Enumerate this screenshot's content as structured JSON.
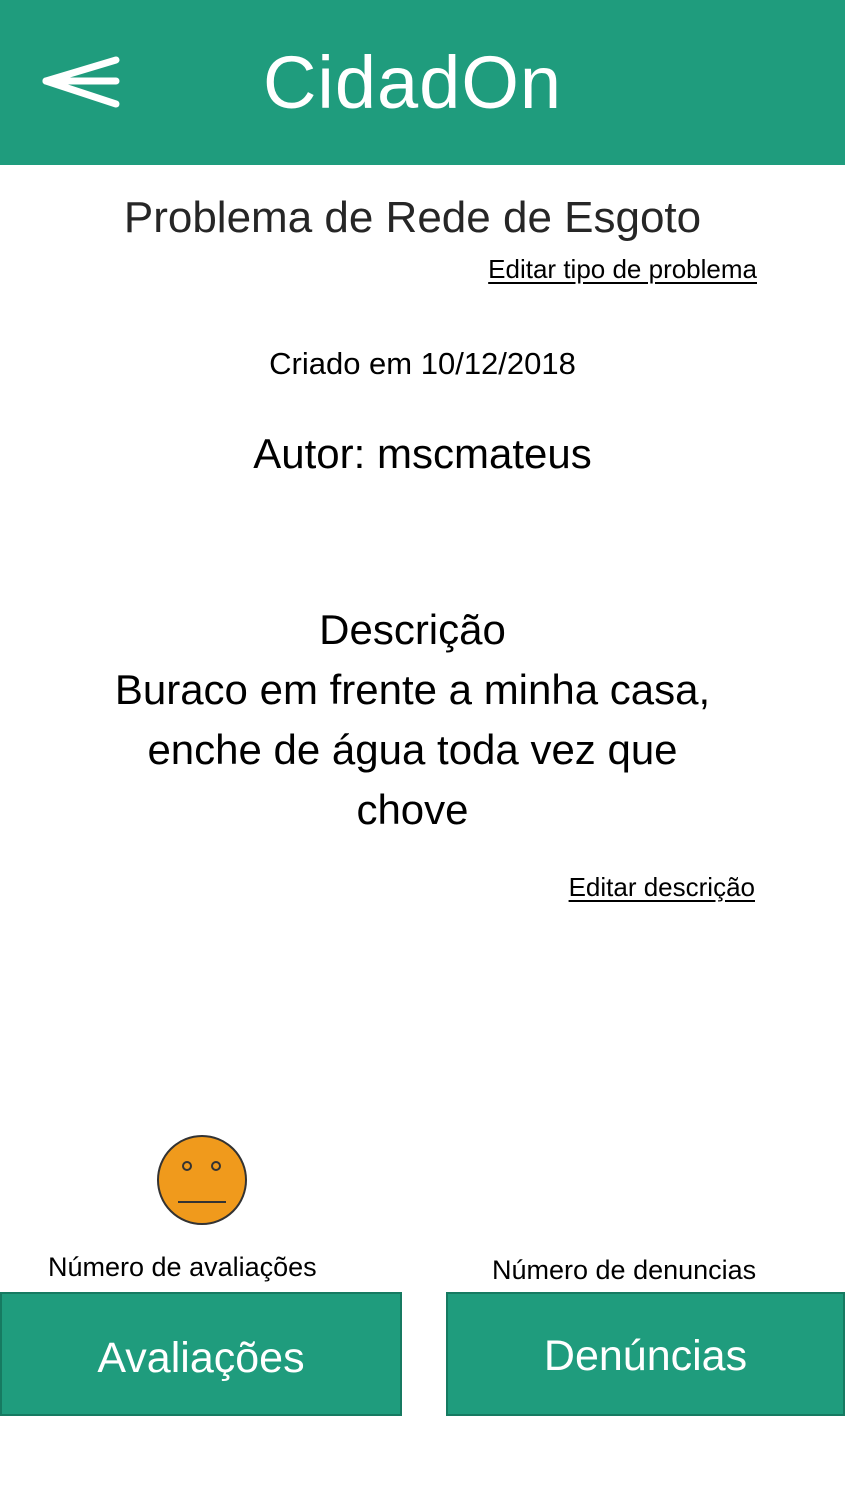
{
  "header": {
    "back_icon": "back-arrow-icon",
    "title": "CidadOn",
    "color": "#1f9c7d"
  },
  "problem": {
    "type_title": "Problema de Rede de Esgoto",
    "edit_type_label": "Editar tipo de problema",
    "created_label": "Criado em 10/12/2018",
    "author_label": "Autor: mscmateus"
  },
  "description": {
    "heading": "Descrição",
    "text": "Buraco em frente a minha casa, enche de água toda vez que chove",
    "edit_label": "Editar descrição"
  },
  "rating": {
    "icon": "neutral-face-icon",
    "icon_color": "#f09a1c",
    "count_label": "Número de avaliações",
    "button_label": "Avaliações"
  },
  "reports": {
    "count_label": "Número de denuncias",
    "button_label": "Denúncias"
  }
}
